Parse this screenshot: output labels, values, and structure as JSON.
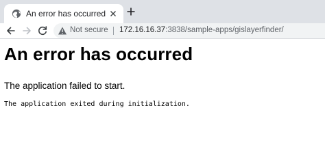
{
  "browser": {
    "tab": {
      "title": "An error has occurred",
      "favicon": "globe-icon"
    },
    "new_tab_icon": "plus-icon",
    "toolbar": {
      "back_icon": "arrow-left-icon",
      "forward_icon": "arrow-right-icon",
      "reload_icon": "reload-icon"
    },
    "address_bar": {
      "security_icon": "warning-icon",
      "security_label": "Not secure",
      "url_host": "172.16.16.37",
      "url_rest": ":3838/sample-apps/gislayerfinder/"
    }
  },
  "page": {
    "heading": "An error has occurred",
    "message": "The application failed to start.",
    "detail": "The application exited during initialization."
  },
  "colors": {
    "tabstrip_bg": "#dee1e6",
    "omnibox_bg": "#f1f3f4",
    "text_primary": "#202124",
    "text_secondary": "#5f6368"
  }
}
